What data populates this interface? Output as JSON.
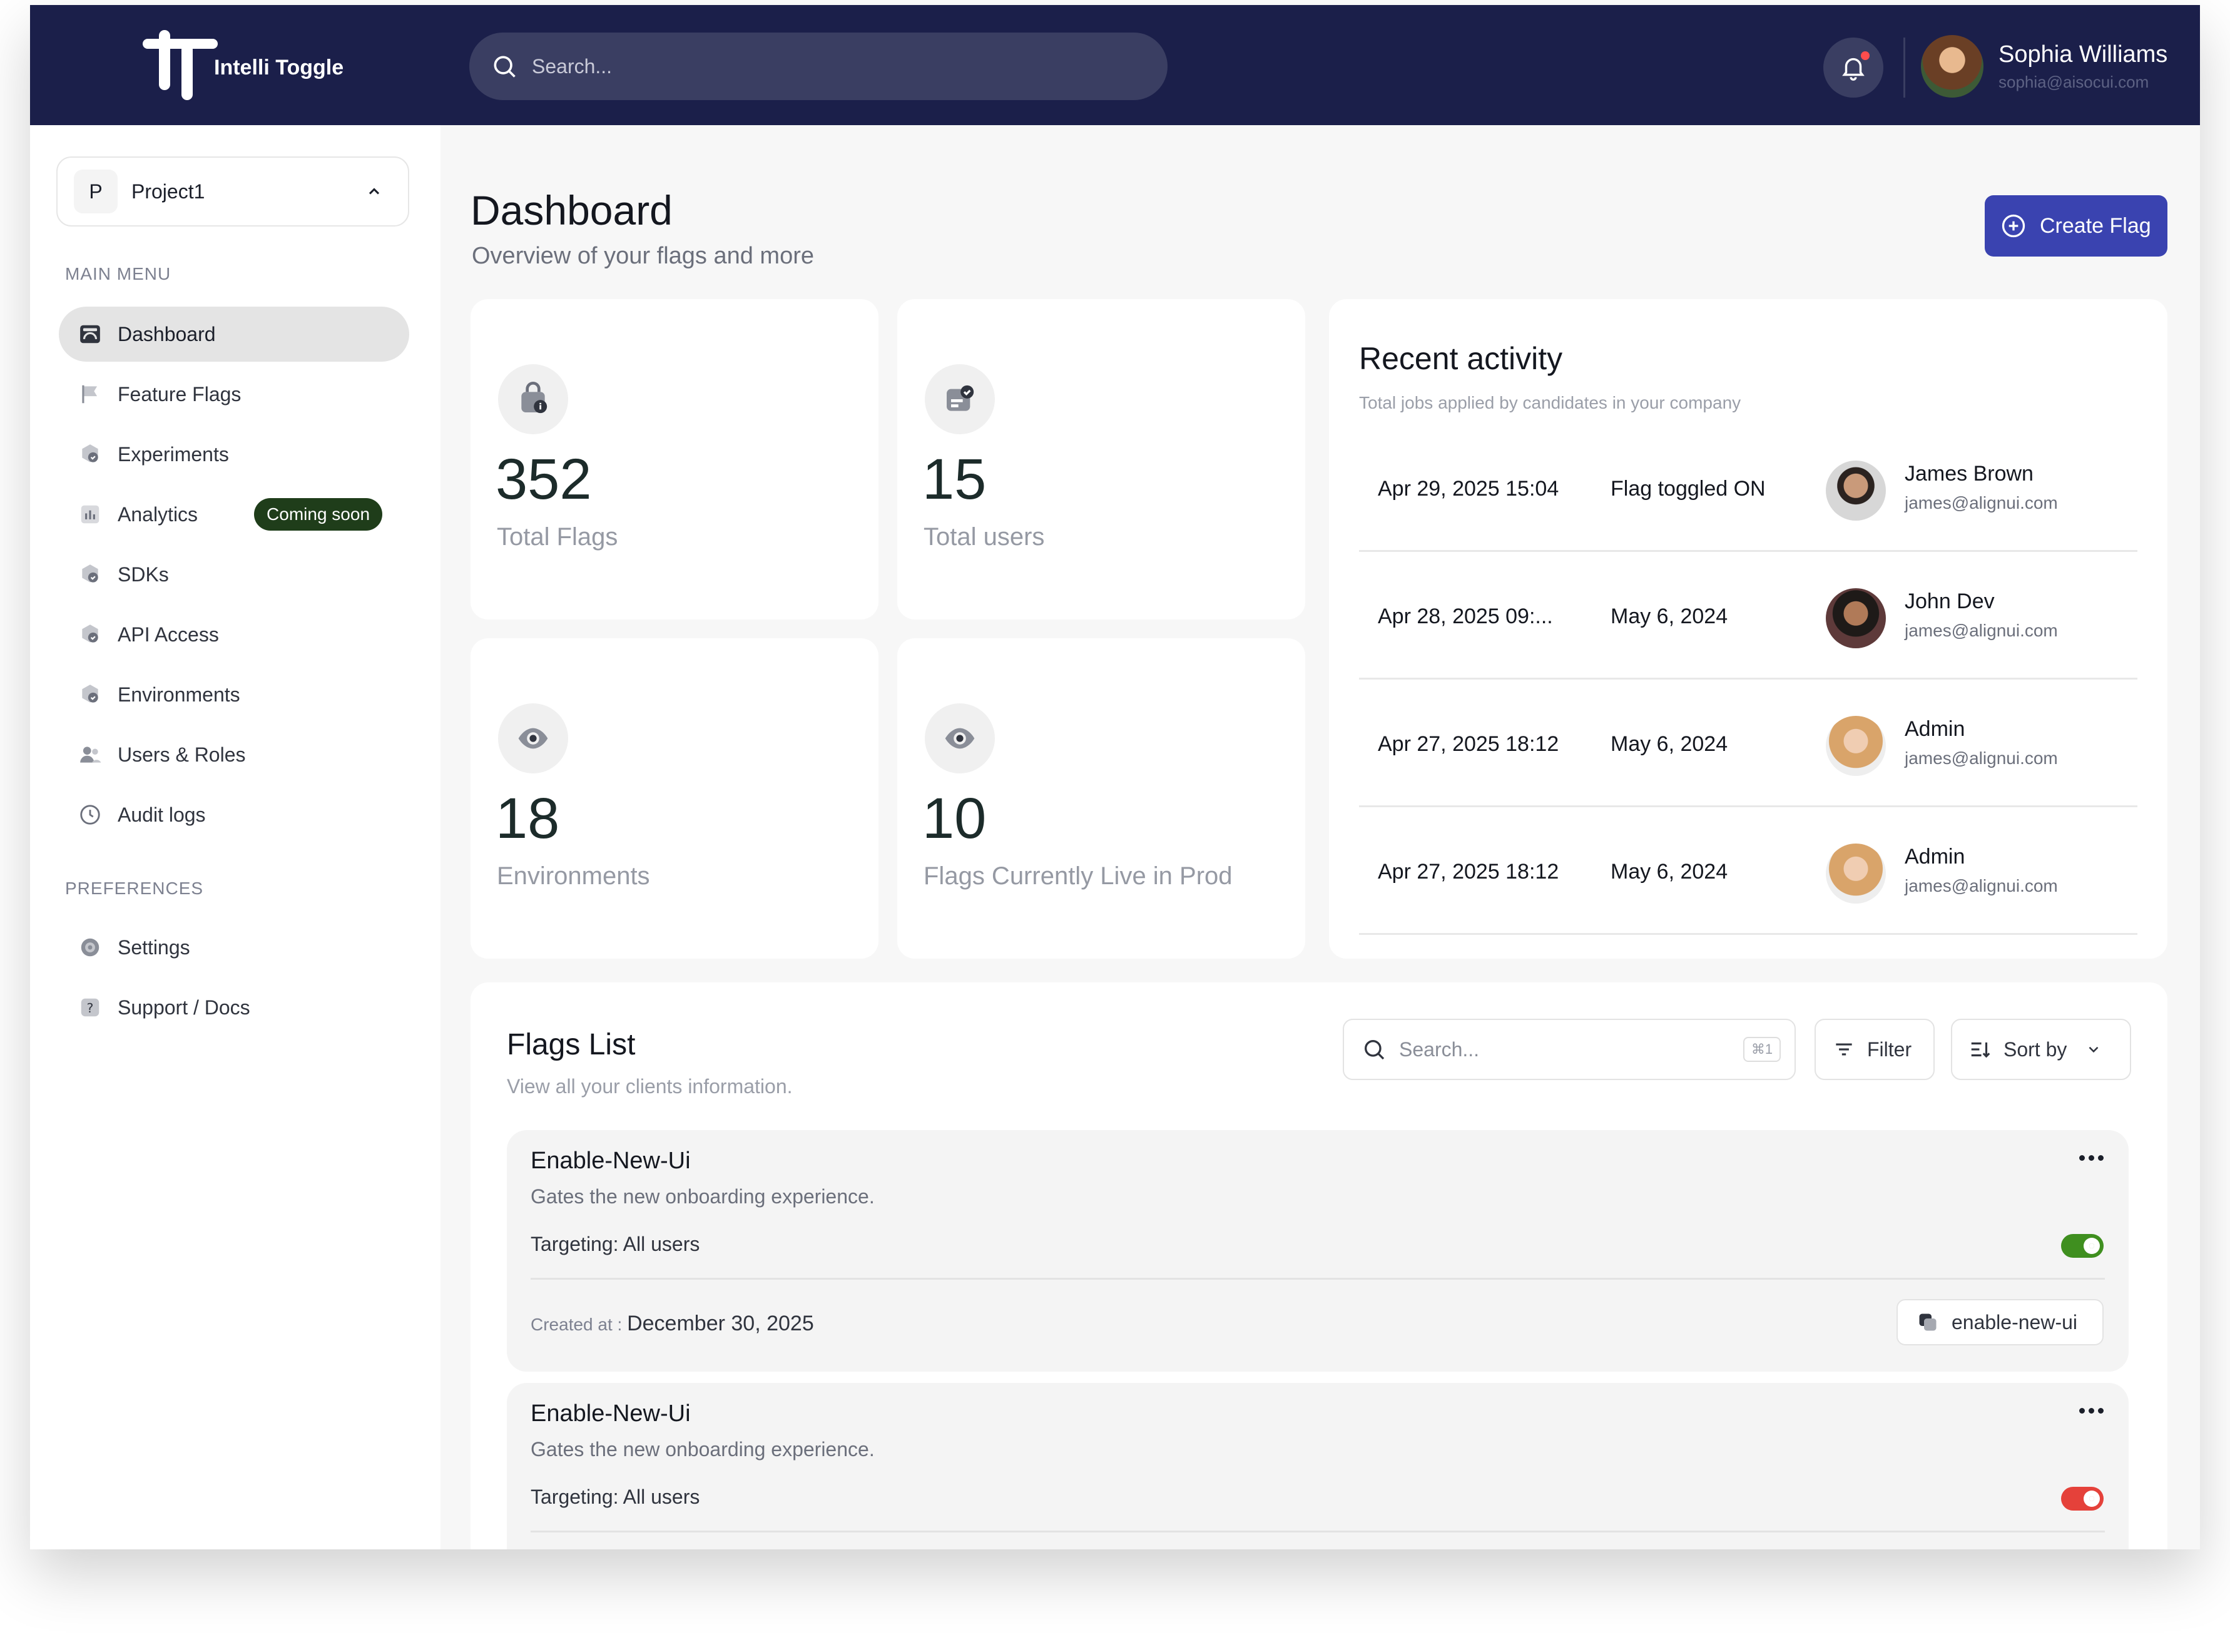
{
  "app": {
    "name": "Intelli Toggle"
  },
  "topbar": {
    "search_placeholder": "Search...",
    "user": {
      "name": "Sophia Williams",
      "email": "sophia@aisocui.com"
    }
  },
  "sidebar": {
    "project": {
      "initial": "P",
      "name": "Project1"
    },
    "main_menu_title": "MAIN MENU",
    "items": [
      {
        "label": "Dashboard",
        "icon": "dashboard-icon",
        "active": true
      },
      {
        "label": "Feature Flags",
        "icon": "flag-icon"
      },
      {
        "label": "Experiments",
        "icon": "experiments-icon"
      },
      {
        "label": "Analytics",
        "icon": "analytics-icon",
        "badge": "Coming soon"
      },
      {
        "label": "SDKs",
        "icon": "sdk-icon"
      },
      {
        "label": "API Access",
        "icon": "api-icon"
      },
      {
        "label": "Environments",
        "icon": "environments-icon"
      },
      {
        "label": "Users & Roles",
        "icon": "users-icon"
      },
      {
        "label": "Audit logs",
        "icon": "clock-icon"
      }
    ],
    "preferences_title": "PREFERENCES",
    "preferences": [
      {
        "label": "Settings",
        "icon": "gear-icon"
      },
      {
        "label": "Support / Docs",
        "icon": "help-icon"
      }
    ]
  },
  "header": {
    "title": "Dashboard",
    "subtitle": "Overview of your flags and more",
    "create_button": "Create Flag"
  },
  "stats": [
    {
      "value": "352",
      "label": "Total Flags",
      "icon": "bag-info-icon"
    },
    {
      "value": "15",
      "label": "Total users",
      "icon": "user-card-icon"
    },
    {
      "value": "18",
      "label": "Environments",
      "icon": "eye-icon"
    },
    {
      "value": "10",
      "label": "Flags Currently Live in Prod",
      "icon": "eye-icon"
    }
  ],
  "recent_activity": {
    "title": "Recent activity",
    "subtitle": "Total jobs applied by candidates in your company",
    "rows": [
      {
        "date": "Apr 29, 2025 15:04",
        "action": "Flag toggled ON",
        "name": "James Brown",
        "email": "james@alignui.com"
      },
      {
        "date": "Apr 28, 2025 09:...",
        "action": "May 6, 2024",
        "name": "John Dev",
        "email": "james@alignui.com"
      },
      {
        "date": "Apr 27, 2025 18:12",
        "action": "May 6, 2024",
        "name": "Admin",
        "email": "james@alignui.com"
      },
      {
        "date": "Apr 27, 2025 18:12",
        "action": "May 6, 2024",
        "name": "Admin",
        "email": "james@alignui.com"
      }
    ]
  },
  "flags_list": {
    "title": "Flags List",
    "subtitle": "View all your clients information.",
    "search_placeholder": "Search...",
    "search_shortcut": "⌘1",
    "filter_label": "Filter",
    "sort_label": "Sort by",
    "items": [
      {
        "name": "Enable-New-Ui",
        "description": "Gates the new onboarding experience.",
        "targeting": "Targeting: All users",
        "enabled": true,
        "created_label": "Created at : ",
        "created_date": "December 30, 2025",
        "key": "enable-new-ui"
      },
      {
        "name": "Enable-New-Ui",
        "description": "Gates the new onboarding experience.",
        "targeting": "Targeting: All users",
        "enabled": false
      }
    ]
  },
  "colors": {
    "topbar": "#1b1f4a",
    "accent": "#3a43b0",
    "toggle_on": "#3f8f1f",
    "toggle_off": "#e5413a",
    "badge": "#1f3d1a"
  }
}
